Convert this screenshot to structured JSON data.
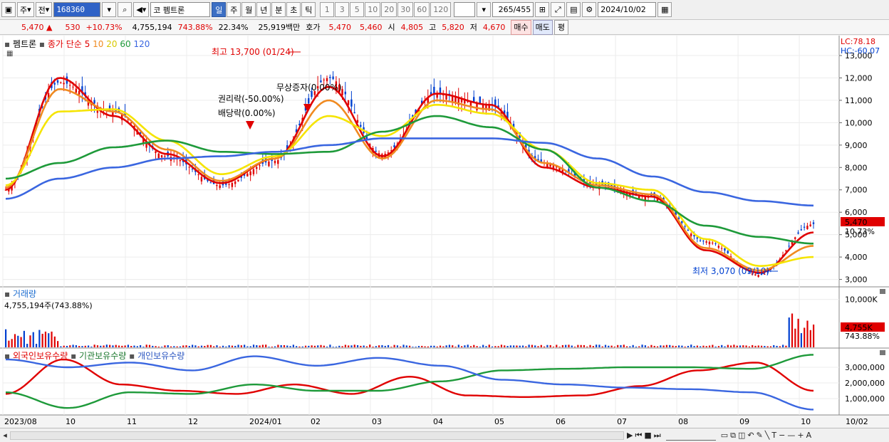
{
  "toolbar": {
    "market_label": "주",
    "prev_label": "전",
    "code": "168360",
    "search_icon": "search-icon",
    "sound_icon": "speaker-icon",
    "market_short": "코",
    "stock_name": "펨트론",
    "period_tabs": [
      "일",
      "주",
      "월",
      "년",
      "분",
      "초",
      "틱"
    ],
    "selected_period": "일",
    "interval_tabs": [
      "1",
      "3",
      "5",
      "10",
      "20",
      "30",
      "60",
      "120"
    ],
    "count_value": "265",
    "count_total": "/455",
    "date_value": "2024/10/02"
  },
  "quote": {
    "price": "5,470",
    "change": "530",
    "change_pct": "+10.73%",
    "volume": "4,755,194",
    "volume_ratio": "743.88%",
    "turnover": "22.34%",
    "amount": "25,919백만",
    "hoga_label": "호가",
    "ask": "5,470",
    "bid": "5,460",
    "open_label": "시",
    "open": "4,805",
    "high_label": "고",
    "high": "5,820",
    "low_label": "저",
    "low": "4,670",
    "buy_label": "매수",
    "sell_label": "매도",
    "eval_label": "평"
  },
  "price_panel": {
    "legend_name": "펨트론",
    "legend_ma": "종가 단순",
    "ma_periods": [
      "5",
      "10",
      "20",
      "60",
      "120"
    ],
    "lc": "LC:78.18",
    "hc": "HC:-60.07",
    "yticks": [
      "13,000",
      "12,000",
      "11,000",
      "10,000",
      "9,000",
      "8,000",
      "7,000",
      "6,000",
      "5,000",
      "4,000",
      "3,000"
    ],
    "last_price": "5,470",
    "last_pct": "10.73%",
    "ann_high": "최고 13,700 (01/24)",
    "ann_low": "최저 3,070 (09/10)",
    "ann_bonus": "무상증자(0.00%)",
    "ann_rights": "권리락(-50.00%)",
    "ann_div": "배당락(0.00%)"
  },
  "volume_panel": {
    "title": "거래량",
    "value": "4,755,194주(743.88%)",
    "ytick": "10,000K",
    "last": "4,755K",
    "last_pct": "743.88%"
  },
  "holdings_panel": {
    "series": [
      "외국인보유수량",
      "기관보유수량",
      "개인보유수량"
    ],
    "yticks": [
      "3,000,000",
      "2,000,000",
      "1,000,000"
    ]
  },
  "xaxis": {
    "labels": [
      "2023/08",
      "10",
      "11",
      "12",
      "2024/01",
      "02",
      "03",
      "04",
      "05",
      "06",
      "07",
      "08",
      "09",
      "10"
    ],
    "right_label": "10/02"
  },
  "colors": {
    "up": "#e00000",
    "down": "#0040d0",
    "ma5": "#e00000",
    "ma10": "#f08a20",
    "ma20": "#f5e400",
    "ma60": "#1e9a3a",
    "ma120": "#3a66e0"
  },
  "chart_data": {
    "type": "line",
    "title": "",
    "ylabel": "",
    "ylim": [
      2700,
      13700
    ],
    "months": [
      "2023/08",
      "10",
      "11",
      "12",
      "2024/01",
      "02",
      "03",
      "04",
      "05",
      "06",
      "07",
      "08",
      "09",
      "10"
    ],
    "close_approx": [
      7000,
      11800,
      10500,
      8500,
      7200,
      8300,
      12000,
      8600,
      11300,
      10800,
      8200,
      7200,
      6700,
      4700,
      3200,
      5470
    ],
    "series": [
      {
        "name": "5",
        "color": "#e00000",
        "values": [
          7000,
          12000,
          10300,
          8600,
          7300,
          8400,
          11600,
          8500,
          11300,
          10800,
          8000,
          7100,
          6700,
          4300,
          3300,
          5100
        ]
      },
      {
        "name": "10",
        "color": "#f08a20",
        "values": [
          7100,
          11500,
          10500,
          8800,
          7400,
          8400,
          11000,
          8400,
          11000,
          10600,
          8200,
          7200,
          6800,
          4400,
          3400,
          4500
        ]
      },
      {
        "name": "20",
        "color": "#f5e400",
        "values": [
          7200,
          10500,
          10600,
          9200,
          7700,
          8500,
          10300,
          9400,
          10800,
          10400,
          8800,
          7300,
          7000,
          4800,
          3600,
          4000
        ]
      },
      {
        "name": "60",
        "color": "#1e9a3a",
        "values": [
          7500,
          8200,
          8900,
          9200,
          8700,
          8600,
          8700,
          9600,
          10300,
          9800,
          8800,
          7100,
          6500,
          5400,
          4900,
          4600
        ]
      },
      {
        "name": "120",
        "color": "#3a66e0",
        "values": [
          6600,
          7500,
          8000,
          8400,
          8500,
          8700,
          9000,
          9300,
          9300,
          9300,
          9100,
          8400,
          7600,
          6900,
          6500,
          6300
        ]
      }
    ],
    "volume_last_k": 4755,
    "holdings": [
      {
        "name": "외국인보유수량",
        "color": "#e00000",
        "values": [
          1300000,
          3500000,
          1900000,
          1500000,
          1300000,
          1900000,
          1300000,
          2400000,
          1200000,
          1100000,
          1200000,
          1800000,
          2800000,
          3300000,
          1500000
        ]
      },
      {
        "name": "기관보유수량",
        "color": "#1e9a3a",
        "values": [
          1400000,
          400000,
          1400000,
          1300000,
          1900000,
          1500000,
          1500000,
          2100000,
          2800000,
          2900000,
          3000000,
          3000000,
          2900000,
          3800000
        ]
      },
      {
        "name": "개인보유수량",
        "color": "#3a66e0",
        "values": [
          3500000,
          3000000,
          3300000,
          2800000,
          3700000,
          3100000,
          3600000,
          3100000,
          2200000,
          1900000,
          1700000,
          1600000,
          1400000,
          300000
        ]
      }
    ]
  }
}
